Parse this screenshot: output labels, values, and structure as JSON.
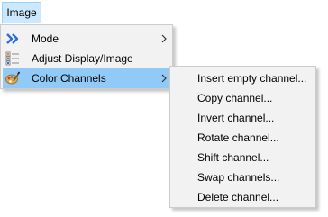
{
  "menubar": {
    "image_label": "Image"
  },
  "menu": {
    "items": [
      {
        "label": "Mode",
        "icon": "double-chevron-right-icon",
        "has_submenu": true,
        "highlighted": false
      },
      {
        "label": "Adjust Display/Image",
        "icon": "adjust-list-icon",
        "has_submenu": false,
        "highlighted": false
      },
      {
        "label": "Color Channels",
        "icon": "palette-icon",
        "has_submenu": true,
        "highlighted": true
      }
    ]
  },
  "submenu": {
    "items": [
      {
        "label": "Insert empty channel..."
      },
      {
        "label": "Copy channel..."
      },
      {
        "label": "Invert channel..."
      },
      {
        "label": "Rotate channel..."
      },
      {
        "label": "Shift channel..."
      },
      {
        "label": "Swap channels..."
      },
      {
        "label": "Delete channel..."
      }
    ]
  },
  "colors": {
    "menu_bg": "#f2f2f2",
    "highlight": "#91c9f7",
    "menubar_active": "#cce8ff",
    "mode_icon": "#2b6fd6"
  }
}
